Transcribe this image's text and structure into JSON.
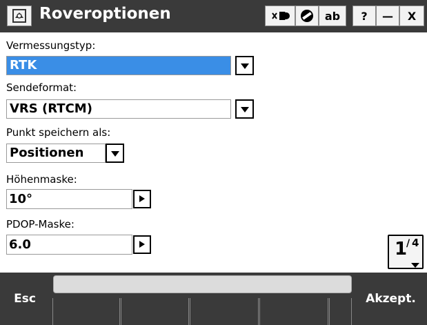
{
  "window": {
    "title": "Roveroptionen",
    "keyboard_button_label": "ab",
    "help_label": "?",
    "minimize_label": "—",
    "close_label": "X"
  },
  "form": {
    "survey_type_label": "Vermessungstyp:",
    "survey_type_value": "RTK",
    "broadcast_format_label": "Sendeformat:",
    "broadcast_format_value": "VRS (RTCM)",
    "store_point_label": "Punkt speichern als:",
    "store_point_value": "Positionen",
    "elevation_mask_label": "Höhenmaske:",
    "elevation_mask_value": "10°",
    "pdop_mask_label": "PDOP-Maske:",
    "pdop_mask_value": "6.0"
  },
  "pager": {
    "current": "1",
    "total": "4"
  },
  "softkeys": {
    "esc_label": "Esc",
    "accept_label": "Akzept."
  },
  "colors": {
    "titlebar": "#3a3a3a",
    "selection": "#3a8ee6"
  },
  "icons": [
    "app-icon",
    "sync-icon",
    "no-entry-icon",
    "chevron-down-icon",
    "play-icon"
  ]
}
